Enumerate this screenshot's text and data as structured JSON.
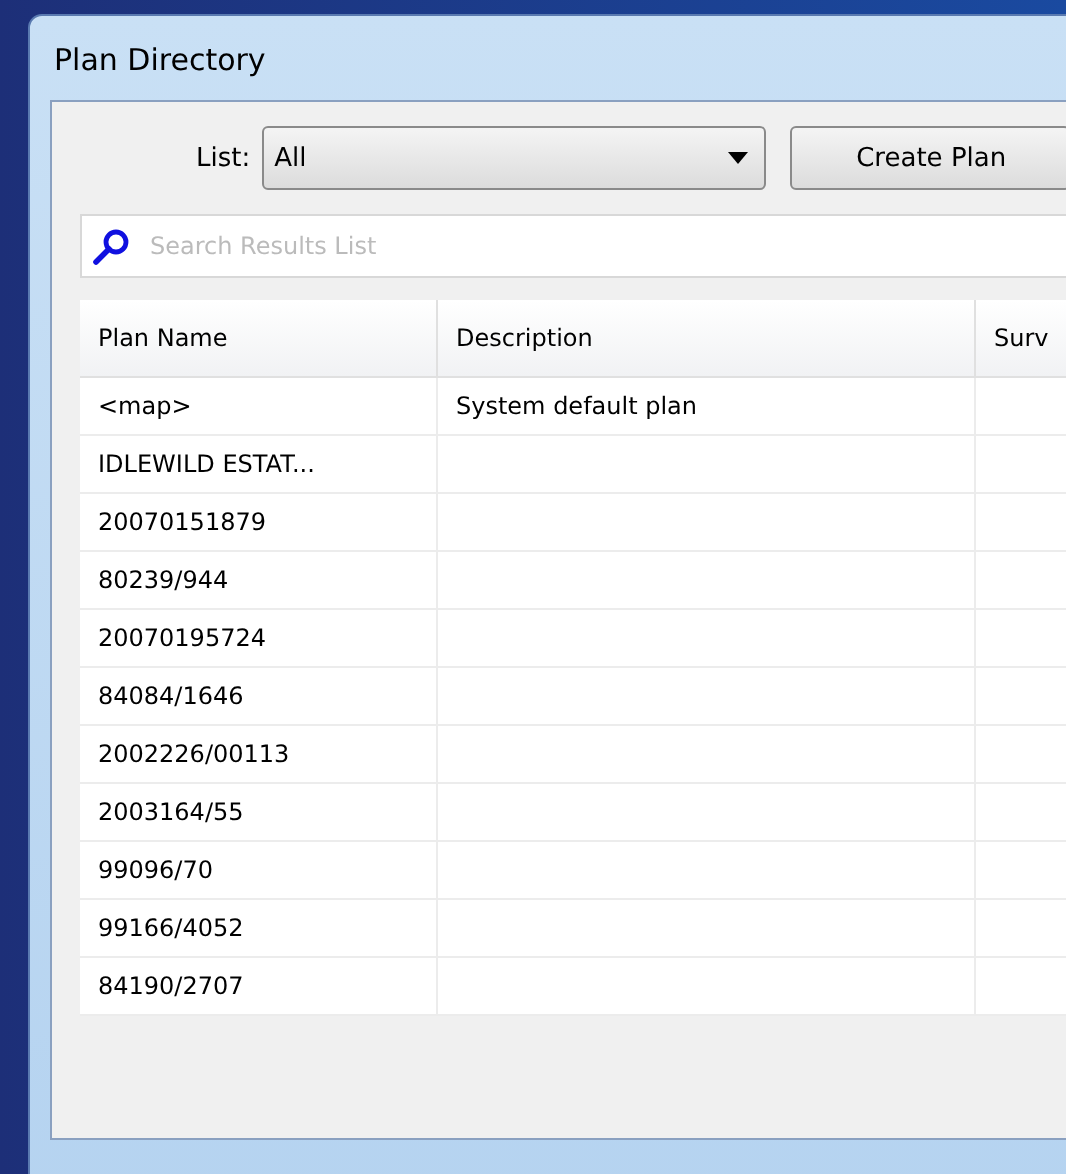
{
  "window": {
    "title": "Plan Directory"
  },
  "toolbar": {
    "list_label": "List:",
    "list_value": "All",
    "create_button": "Create Plan"
  },
  "search": {
    "placeholder": "Search Results List"
  },
  "table": {
    "columns": [
      "Plan Name",
      "Description",
      "Surv"
    ],
    "rows": [
      {
        "plan_name": "<map>",
        "description": "System default plan"
      },
      {
        "plan_name": "IDLEWILD ESTAT..."
      },
      {
        "plan_name": "20070151879"
      },
      {
        "plan_name": "80239/944"
      },
      {
        "plan_name": "20070195724"
      },
      {
        "plan_name": "84084/1646"
      },
      {
        "plan_name": "2002226/00113"
      },
      {
        "plan_name": "2003164/55"
      },
      {
        "plan_name": "99096/70"
      },
      {
        "plan_name": "99166/4052"
      },
      {
        "plan_name": "84190/2707"
      }
    ]
  }
}
